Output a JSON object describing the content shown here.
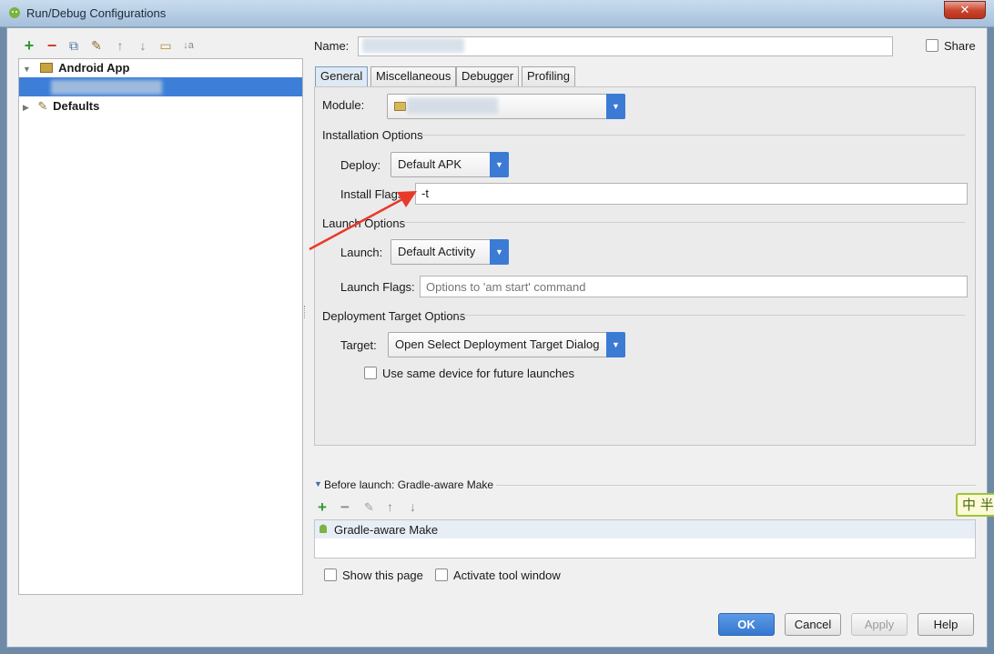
{
  "window": {
    "title": "Run/Debug Configurations",
    "close_glyph": "✕"
  },
  "toolbar_icons": [
    {
      "name": "add-icon",
      "glyph": "+",
      "color": "#2e9b2e"
    },
    {
      "name": "remove-icon",
      "glyph": "−",
      "color": "#d33a2c"
    },
    {
      "name": "copy-icon",
      "glyph": "⧉",
      "color": "#4d6fa0"
    },
    {
      "name": "wrench-icon",
      "glyph": "✎",
      "color": "#8a6d2e"
    },
    {
      "name": "move-up-icon",
      "glyph": "↑",
      "color": "#8a8a8a"
    },
    {
      "name": "move-down-icon",
      "glyph": "↓",
      "color": "#8a8a8a"
    },
    {
      "name": "folder-icon",
      "glyph": "▭",
      "color": "#b48a2d"
    },
    {
      "name": "sort-icon",
      "glyph": "↓",
      "color": "#8a8a8a"
    }
  ],
  "tree": {
    "android_app": "Android App",
    "defaults": "Defaults"
  },
  "name_field": {
    "label": "Name:",
    "value": ""
  },
  "share": {
    "label": "Share"
  },
  "tabs": [
    "General",
    "Miscellaneous",
    "Debugger",
    "Profiling"
  ],
  "general": {
    "module_label": "Module:",
    "installation_options": "Installation Options",
    "deploy_label": "Deploy:",
    "deploy_value": "Default APK",
    "install_flags_label": "Install Flags:",
    "install_flags_value": "-t",
    "launch_options": "Launch Options",
    "launch_label": "Launch:",
    "launch_value": "Default Activity",
    "launch_flags_label": "Launch Flags:",
    "launch_flags_placeholder": "Options to 'am start' command",
    "deployment_target_options": "Deployment Target Options",
    "target_label": "Target:",
    "target_value": "Open Select Deployment Target Dialog",
    "same_device_label": "Use same device for future launches"
  },
  "before_launch": {
    "header": "Before launch: Gradle-aware Make",
    "items": [
      "Gradle-aware Make"
    ]
  },
  "ime_badge": "中 半",
  "footer": {
    "show_page": "Show this page",
    "activate_tool_window": "Activate tool window",
    "ok": "OK",
    "cancel": "Cancel",
    "apply": "Apply",
    "help": "Help"
  }
}
